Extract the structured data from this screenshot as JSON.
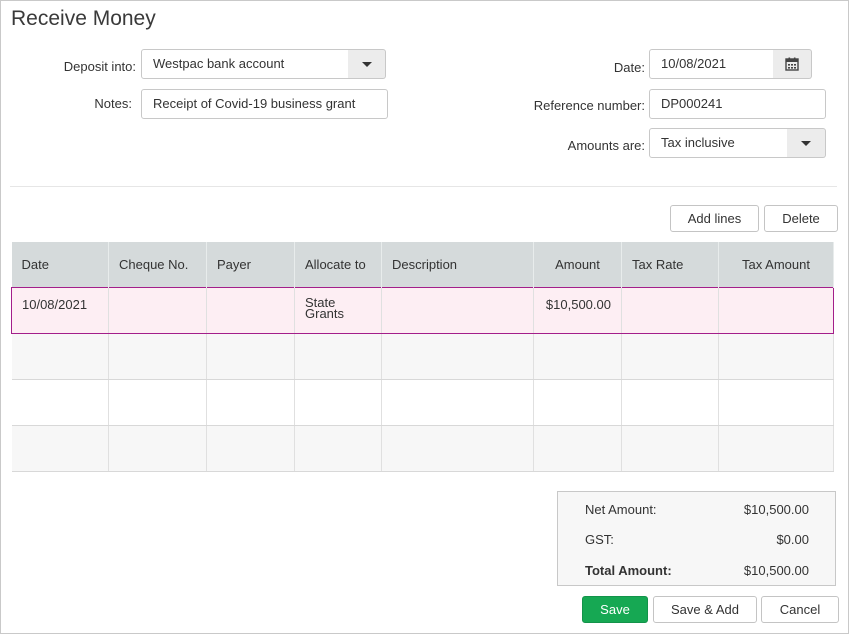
{
  "page": {
    "title": "Receive Money"
  },
  "form": {
    "deposit_label": "Deposit into:",
    "deposit_value": "Westpac bank account",
    "notes_label": "Notes:",
    "notes_value": "Receipt of Covid-19 business grant",
    "date_label": "Date:",
    "date_value": "10/08/2021",
    "ref_label": "Reference number:",
    "ref_value": "DP000241",
    "amounts_label": "Amounts are:",
    "amounts_value": "Tax inclusive"
  },
  "actions": {
    "add_lines": "Add lines",
    "delete": "Delete"
  },
  "table": {
    "headers": [
      "Date",
      "Cheque No.",
      "Payer",
      "Allocate to",
      "Description",
      "Amount",
      "Tax Rate",
      "Tax Amount"
    ],
    "rows": [
      {
        "date": "10/08/2021",
        "cheque": "",
        "payer": "",
        "allocate_line1": "State",
        "allocate_line2": "Grants",
        "description": "",
        "amount": "$10,500.00",
        "tax_rate": "",
        "tax_amount": ""
      }
    ]
  },
  "totals": {
    "net_label": "Net Amount:",
    "net_value": "$10,500.00",
    "gst_label": "GST:",
    "gst_value": "$0.00",
    "total_label": "Total Amount:",
    "total_value": "$10,500.00"
  },
  "footer": {
    "save": "Save",
    "save_add": "Save & Add",
    "cancel": "Cancel"
  },
  "colors": {
    "primary": "#16a853",
    "header_bg": "#d5dadb",
    "selected_row": "#fdeef3",
    "selected_border": "#a31e8a"
  },
  "icons": {
    "date_picker": "calendar-icon",
    "dropdown": "chevron-down-icon"
  }
}
